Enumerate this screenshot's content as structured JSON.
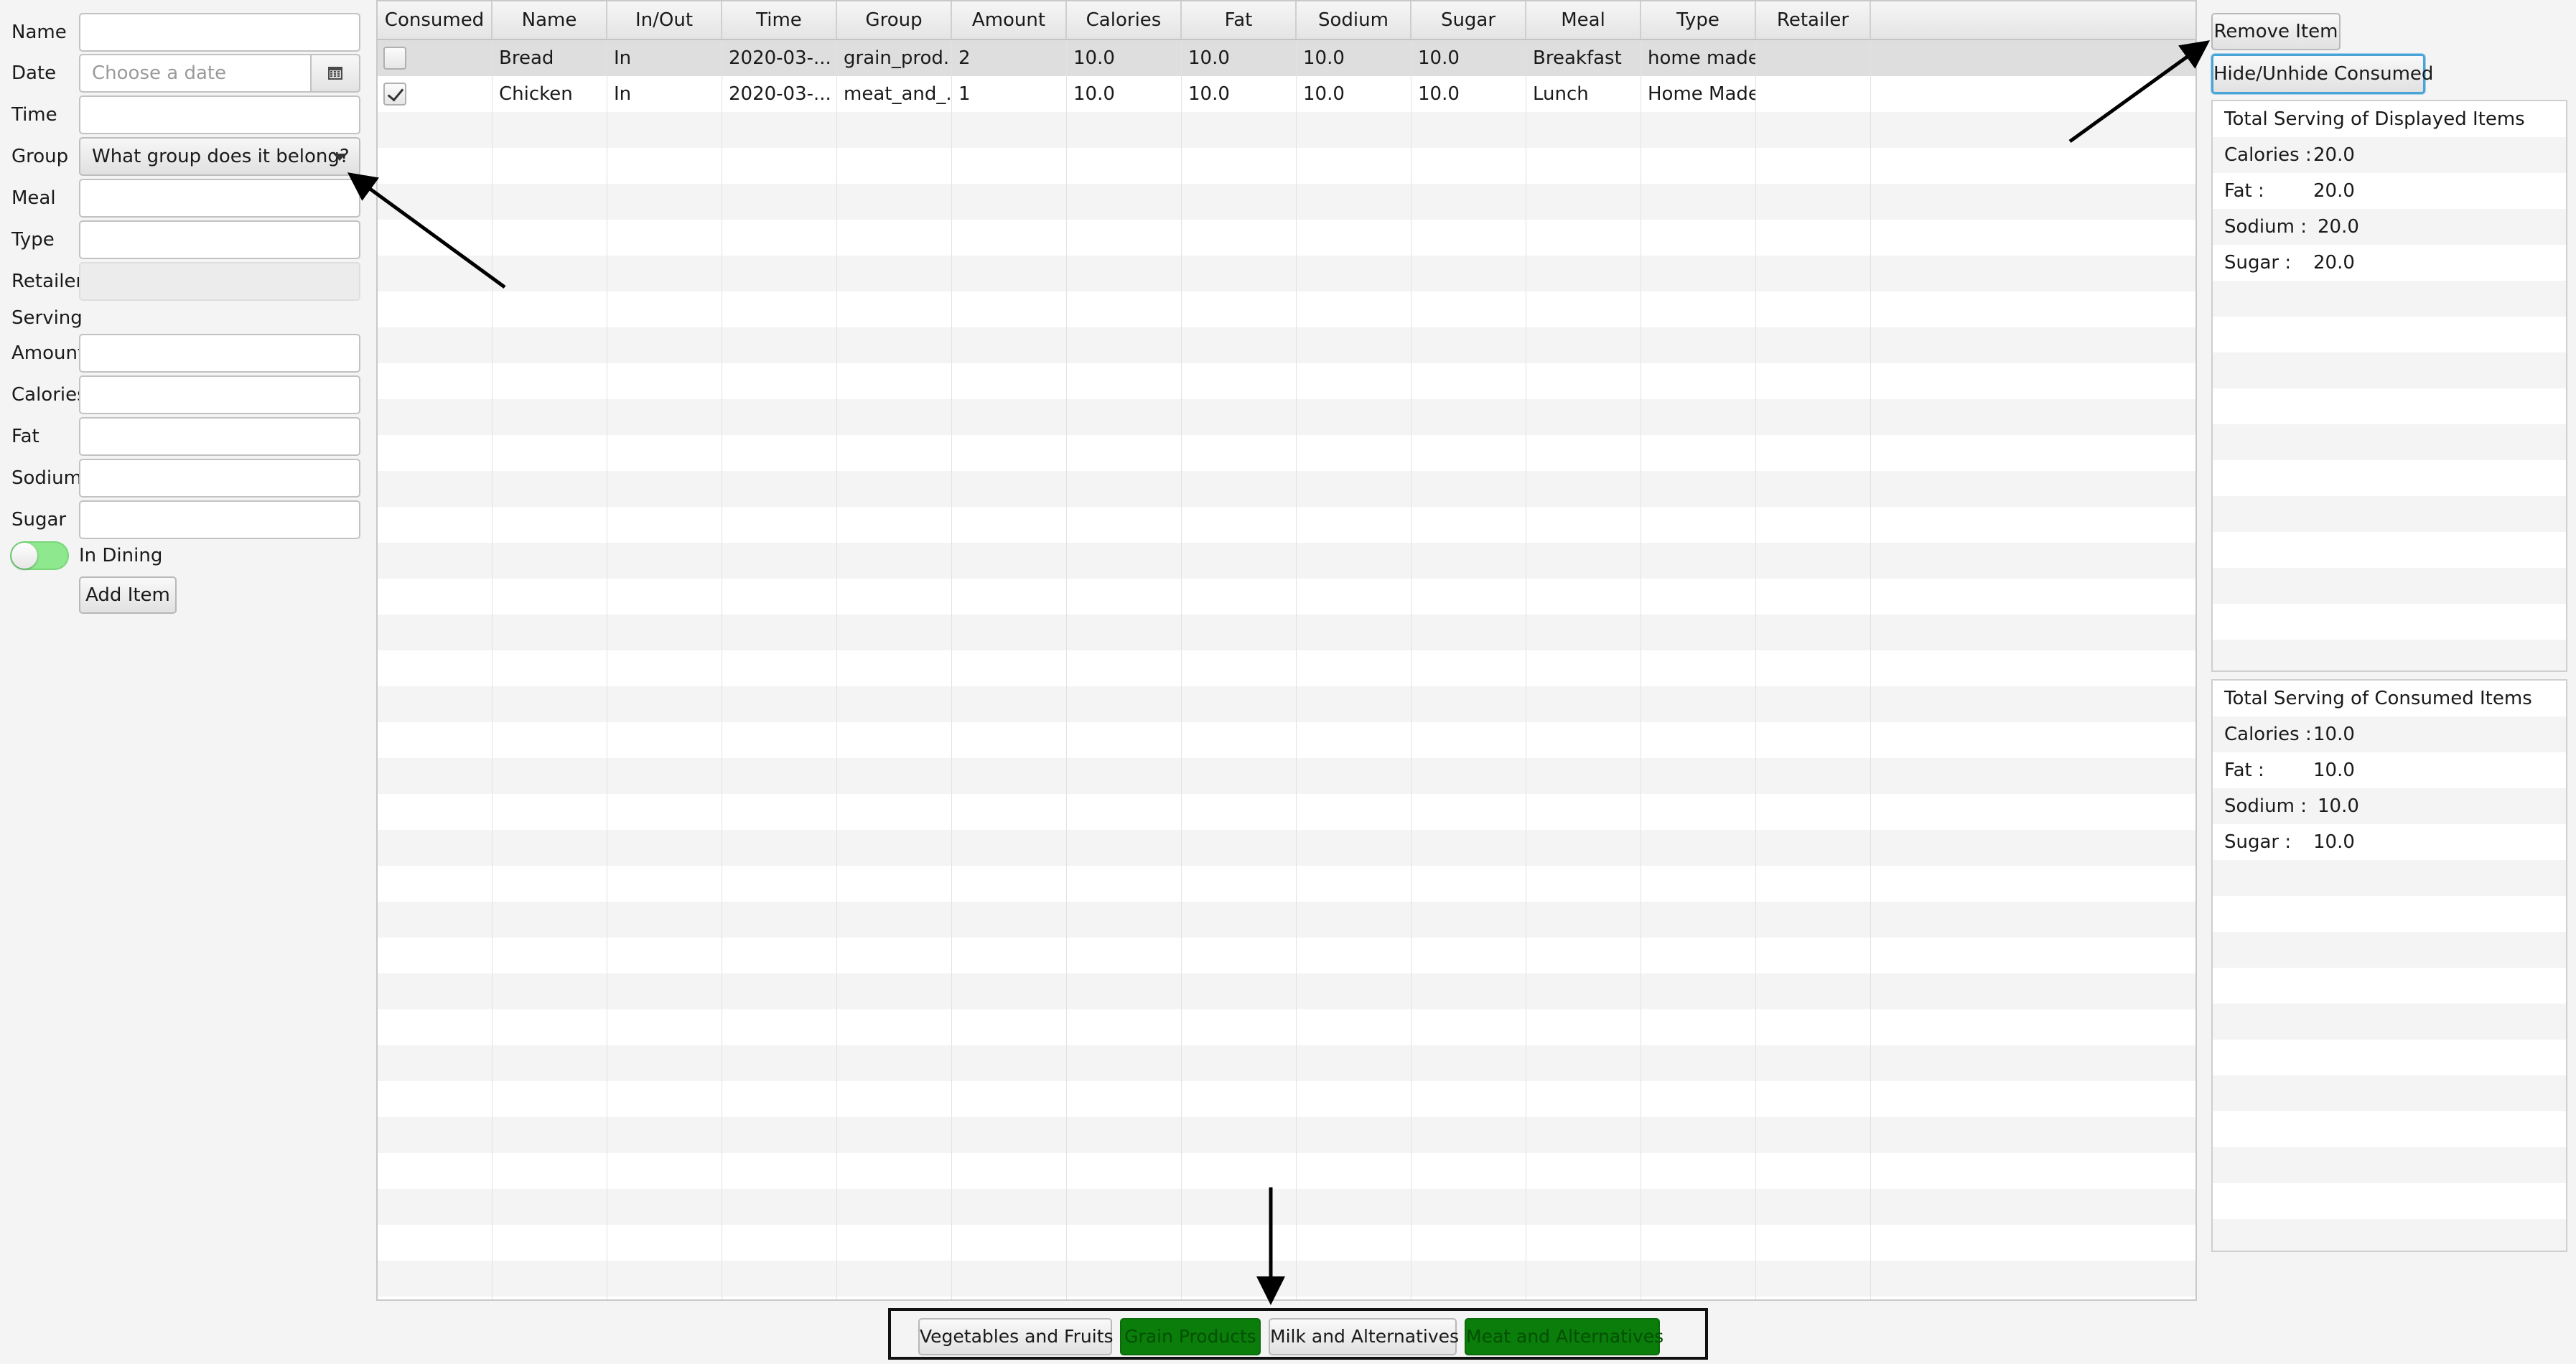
{
  "form": {
    "name_label": "Name",
    "name_value": "",
    "date_label": "Date",
    "date_placeholder": "Choose a date",
    "time_label": "Time",
    "time_value": "",
    "group_label": "Group",
    "group_selected": "What group does it belong?",
    "meal_label": "Meal",
    "meal_value": "",
    "type_label": "Type",
    "type_value": "",
    "retailer_label": "Retailer",
    "retailer_value": "",
    "serving_label": "Serving",
    "amount_label": "Amount",
    "amount_value": "",
    "calories_label": "Calories",
    "calories_value": "",
    "fat_label": "Fat",
    "fat_value": "",
    "sodium_label": "Sodium",
    "sodium_value": "",
    "sugar_label": "Sugar",
    "sugar_value": "",
    "dining_toggle_label": "In Dining",
    "dining_toggle_on": true,
    "add_button": "Add Item",
    "calendar_icon": "calendar-icon",
    "toggle_color": "#8ee98e"
  },
  "table": {
    "columns": [
      "Consumed",
      "Name",
      "In/Out",
      "Time",
      "Group",
      "Amount",
      "Calories",
      "Fat",
      "Sodium",
      "Sugar",
      "Meal",
      "Type",
      "Retailer"
    ],
    "rows": [
      {
        "consumed": false,
        "name": "Bread",
        "inout": "In",
        "time": "2020-03-...",
        "group": "grain_prod...",
        "amount": "2",
        "calories": "10.0",
        "fat": "10.0",
        "sodium": "10.0",
        "sugar": "10.0",
        "meal": "Breakfast",
        "type": "home made",
        "retailer": "",
        "selected": true
      },
      {
        "consumed": true,
        "name": "Chicken",
        "inout": "In",
        "time": "2020-03-...",
        "group": "meat_and_...",
        "amount": "1",
        "calories": "10.0",
        "fat": "10.0",
        "sodium": "10.0",
        "sugar": "10.0",
        "meal": "Lunch",
        "type": "Home Made",
        "retailer": "",
        "selected": false
      }
    ]
  },
  "right_panel": {
    "remove_button": "Remove Item",
    "hide_button": "Hide/Unhide Consumed",
    "displayed": {
      "title": "Total Serving of Displayed Items",
      "calories_label": "Calories :",
      "calories_value": "20.0",
      "fat_label": "Fat :",
      "fat_value": "20.0",
      "sodium_label": "Sodium :",
      "sodium_value": "20.0",
      "sugar_label": "Sugar :",
      "sugar_value": "20.0"
    },
    "consumed": {
      "title": "Total Serving of Consumed Items",
      "calories_label": "Calories :",
      "calories_value": "10.0",
      "fat_label": "Fat :",
      "fat_value": "10.0",
      "sodium_label": "Sodium :",
      "sodium_value": "10.0",
      "sugar_label": "Sugar :",
      "sugar_value": "10.0"
    }
  },
  "filter_bar": {
    "buttons": [
      {
        "label": "Vegetables and Fruits",
        "active": false
      },
      {
        "label": "Grain Products",
        "active": true
      },
      {
        "label": "Milk and Alternatives",
        "active": false
      },
      {
        "label": "Meat and Alternatives",
        "active": true
      }
    ],
    "active_color": "#0a7d0a"
  }
}
